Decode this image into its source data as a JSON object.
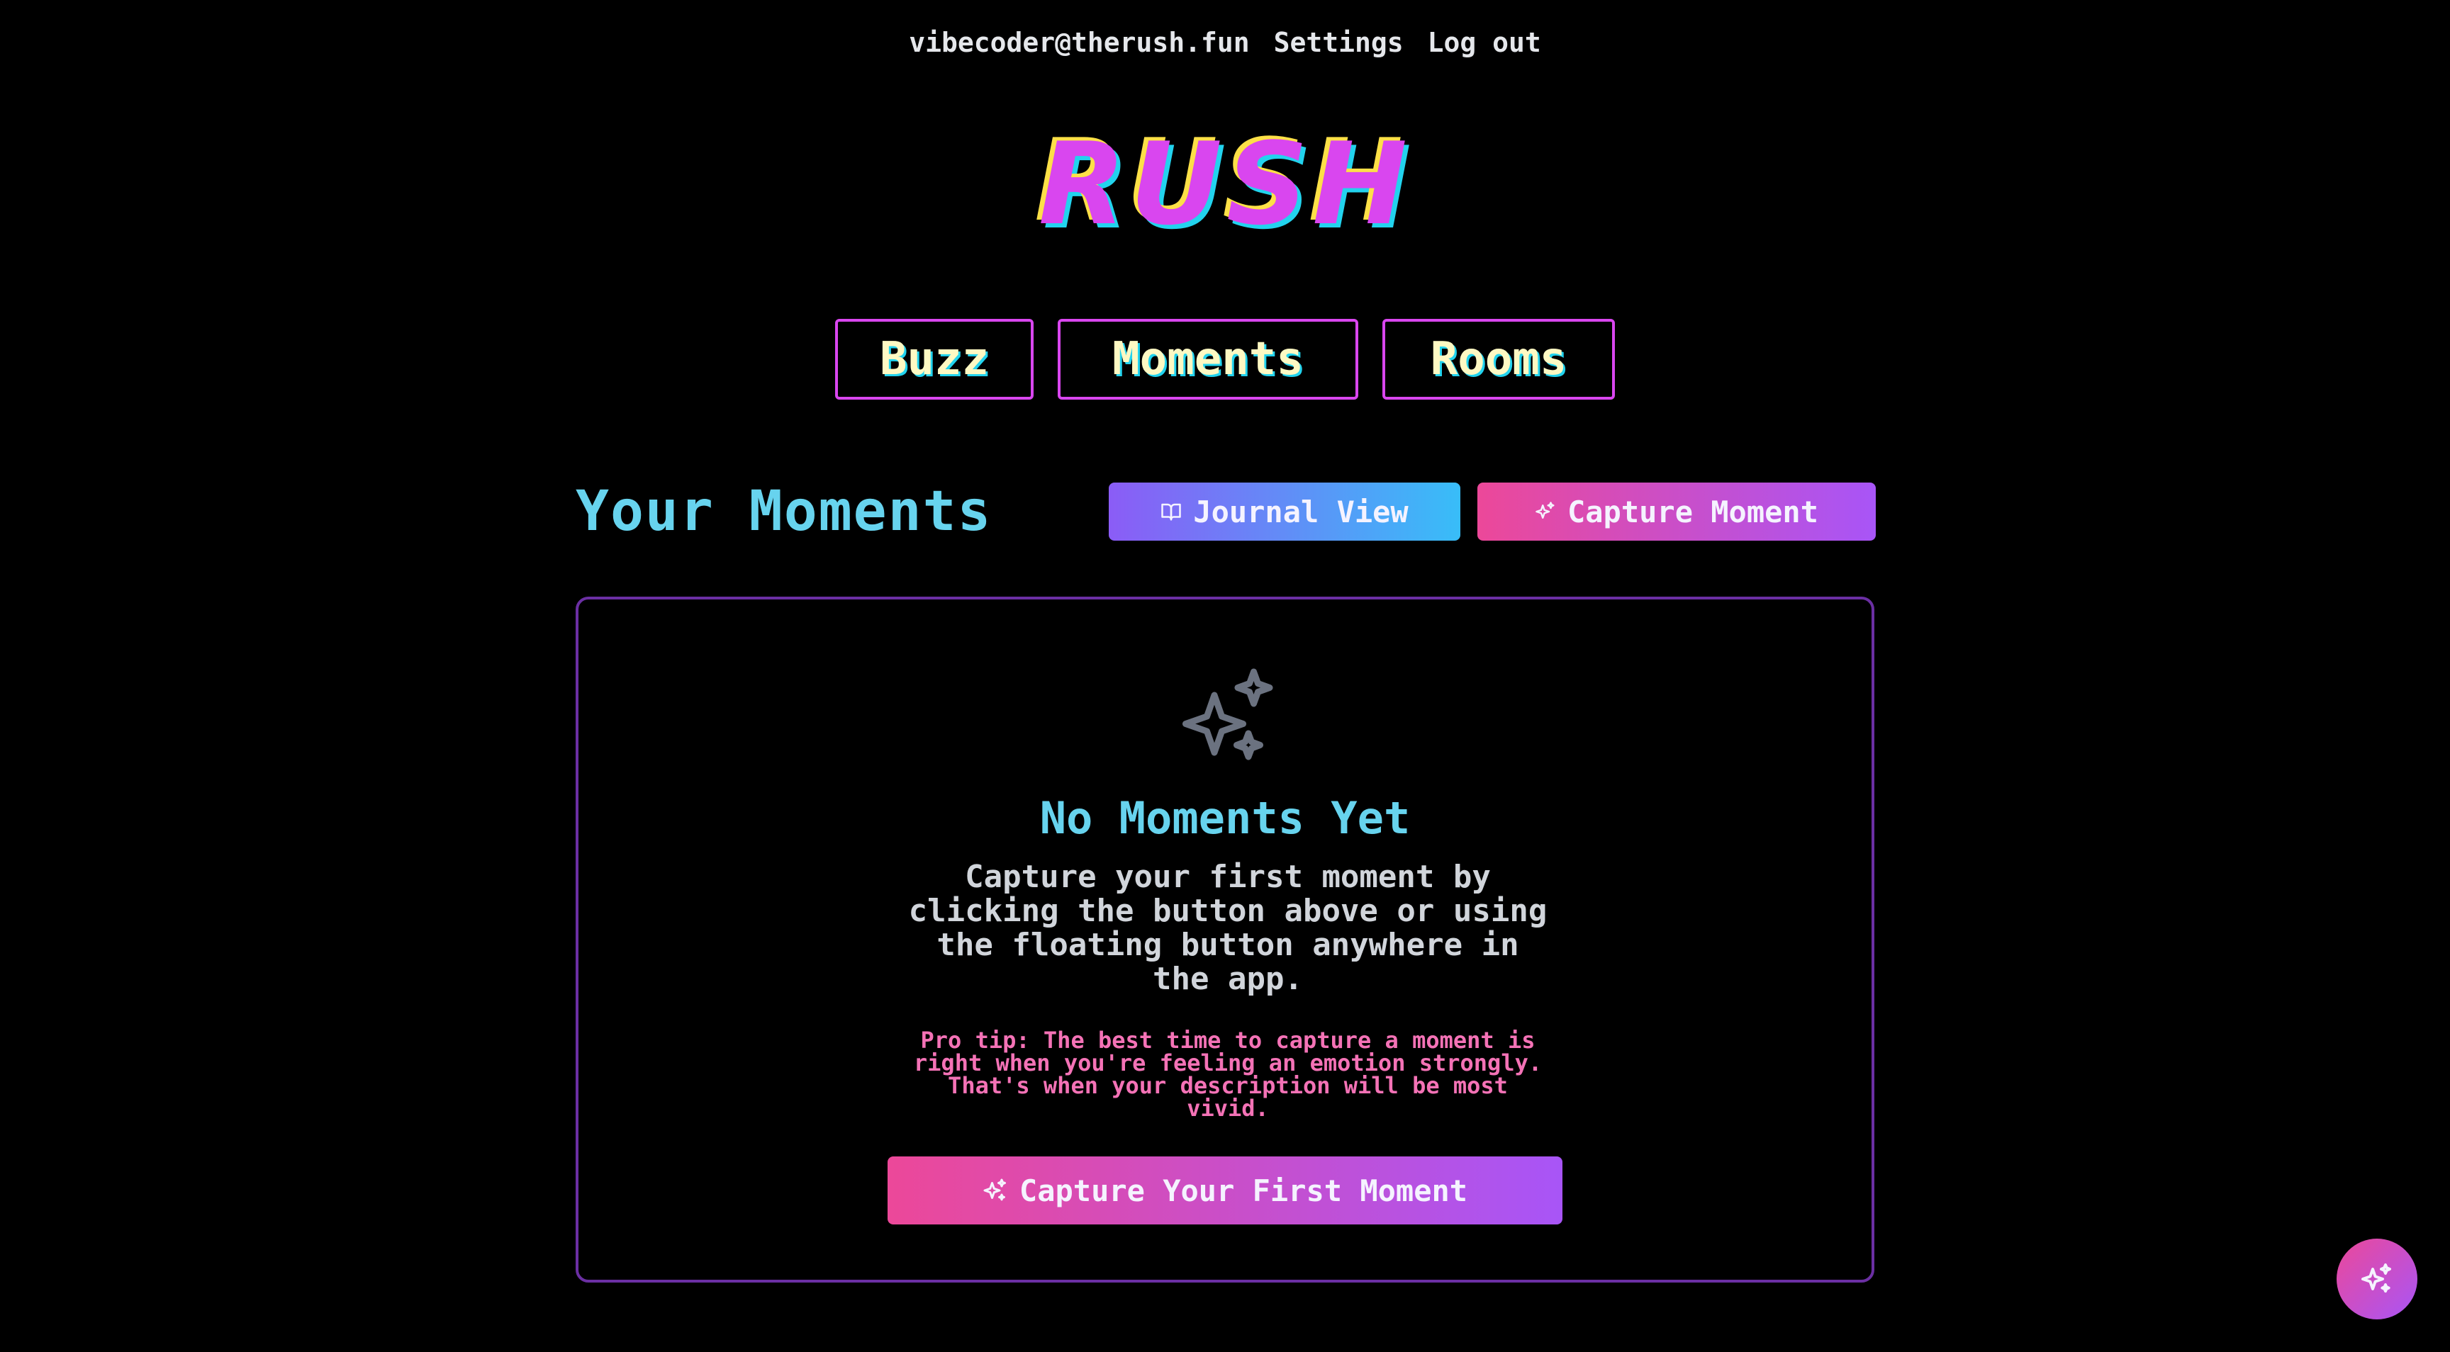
{
  "account": {
    "email": "vibecoder@therush.fun",
    "settings_label": "Settings",
    "logout_label": "Log out"
  },
  "brand": {
    "logo_text": "RUSH",
    "colors": {
      "logo_fill": "#d946ef",
      "logo_shadow_yellow": "#fde047",
      "logo_shadow_cyan": "#22d3ee",
      "accent_magenta": "#d946ef",
      "title_cyan": "#67d3ee",
      "tip_pink": "#f472b6",
      "card_border": "#6b2fa3"
    }
  },
  "nav": {
    "items": [
      {
        "label": "Buzz"
      },
      {
        "label": "Moments"
      },
      {
        "label": "Rooms"
      }
    ]
  },
  "moments": {
    "title": "Your Moments",
    "journal_view_label": "Journal View",
    "journal_icon": "book-open-icon",
    "capture_label": "Capture Moment",
    "capture_icon": "sparkles-icon"
  },
  "empty_state": {
    "icon": "sparkles-icon",
    "title": "No Moments Yet",
    "description": "Capture your first moment by clicking the button above or using the floating button anywhere in the app.",
    "tip": "Pro tip: The best time to capture a moment is right when you're feeling an emotion strongly. That's when your description will be most vivid.",
    "cta_label": "Capture Your First Moment"
  },
  "fab": {
    "icon": "sparkles-icon"
  }
}
